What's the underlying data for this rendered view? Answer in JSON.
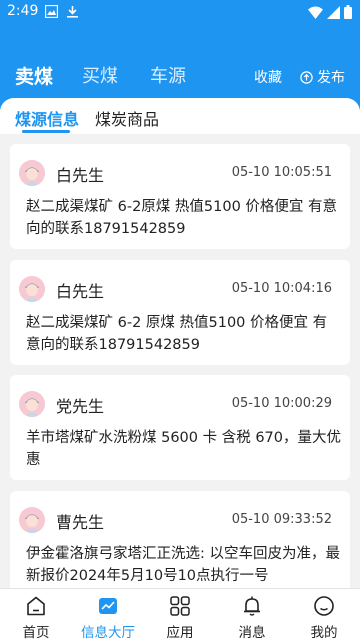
{
  "status_bar": {
    "time": "2:49"
  },
  "top_nav": {
    "tabs": [
      {
        "label": "卖煤"
      },
      {
        "label": "买煤"
      },
      {
        "label": "车源"
      }
    ],
    "collect_label": "收藏",
    "publish_label": "发布"
  },
  "sub_tabs": [
    {
      "label": "煤源信息"
    },
    {
      "label": "煤炭商品"
    }
  ],
  "posts": [
    {
      "name": "白先生",
      "time": "05-10 10:05:51",
      "content": "赵二成渠煤矿 6-2原煤 热值5100 价格便宜 有意向的联系18791542859"
    },
    {
      "name": "白先生",
      "time": "05-10 10:04:16",
      "content": "赵二成渠煤矿 6-2 原煤 热值5100 价格便宜 有意向的联系18791542859"
    },
    {
      "name": "党先生",
      "time": "05-10 10:00:29",
      "content": "羊市塔煤矿水洗粉煤 5600 卡 含税 670，量大优惠"
    },
    {
      "name": "曹先生",
      "time": "05-10 09:33:52",
      "content": "伊金霍洛旗弓家塔汇正洗选: 以空车回皮为准，最新报价2024年5月10号10点执行一号"
    }
  ],
  "bottom_tabs": [
    {
      "label": "首页"
    },
    {
      "label": "信息大厅"
    },
    {
      "label": "应用"
    },
    {
      "label": "消息"
    },
    {
      "label": "我的"
    }
  ],
  "colors": {
    "accent": "#1e95f0",
    "avatar_bg": "#f7c9d3"
  }
}
